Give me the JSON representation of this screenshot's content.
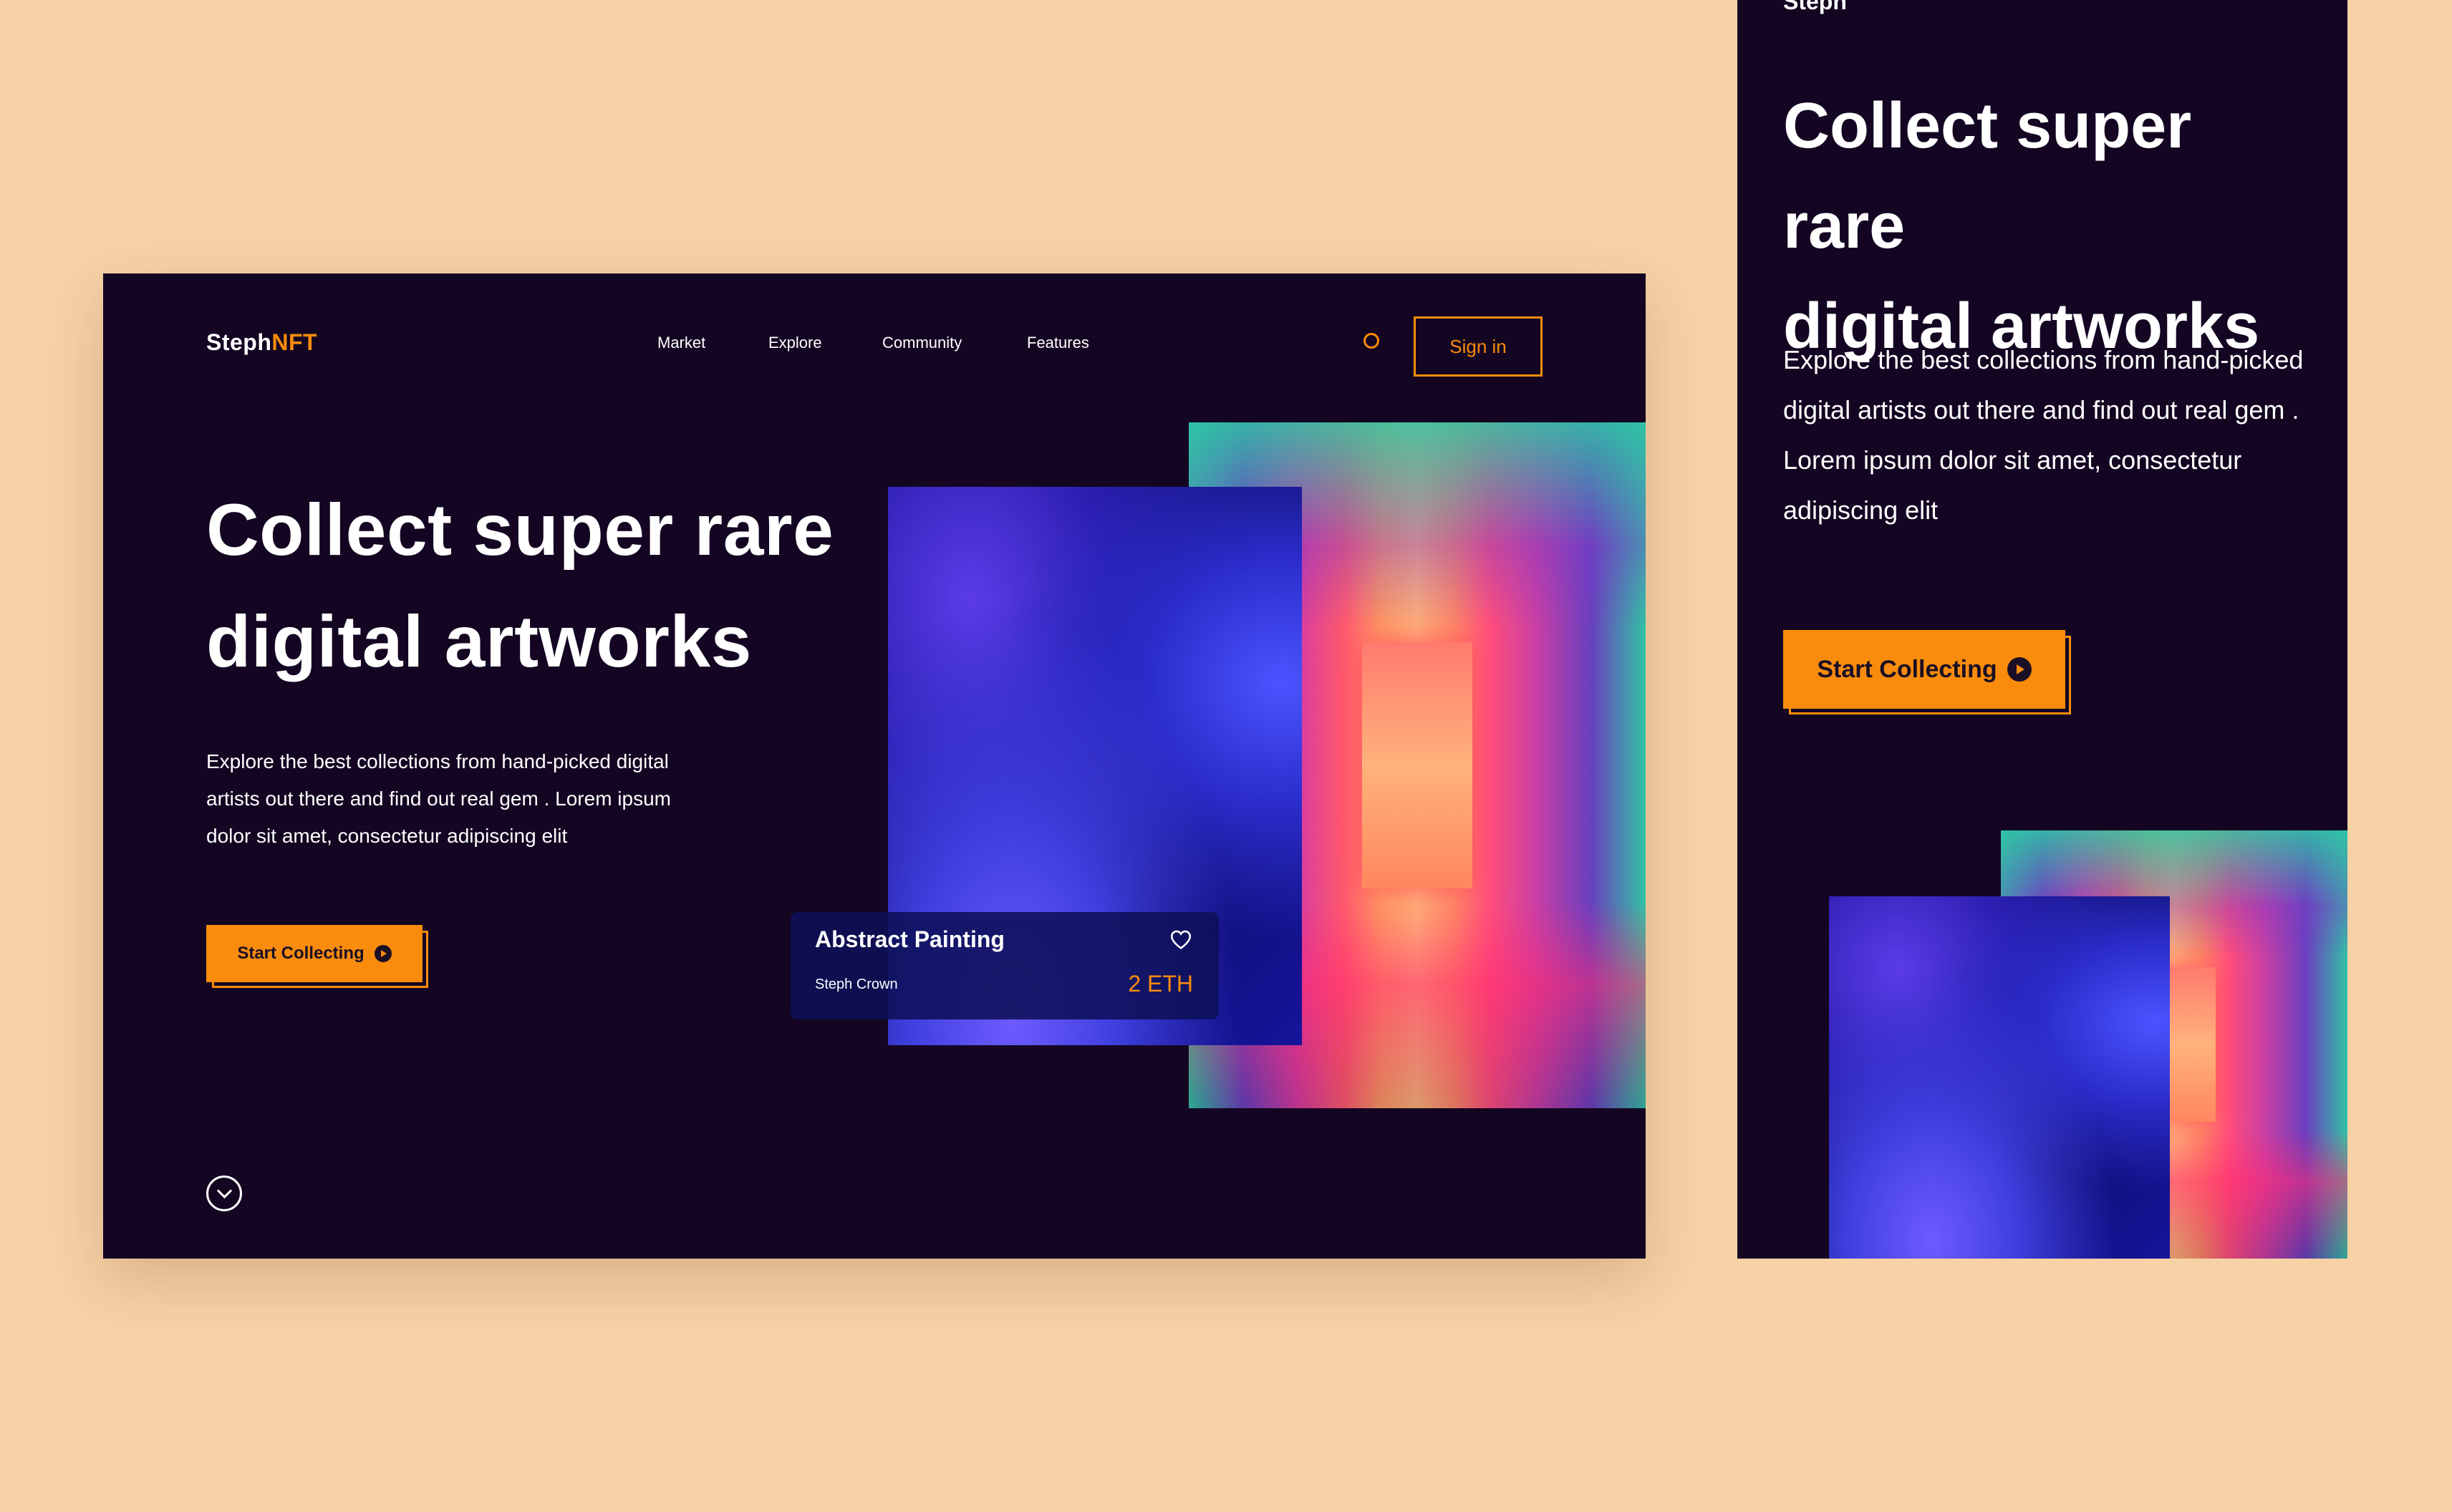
{
  "desktop": {
    "brand": {
      "primary": "Steph",
      "accent": "NFT"
    },
    "nav": [
      "Market",
      "Explore",
      "Community",
      "Features"
    ],
    "sign_in": "Sign in",
    "hero": {
      "title_line1": "Collect super rare",
      "title_line2": "digital artworks",
      "description": "Explore the best collections from hand-picked digital artists out there and find out real gem . Lorem ipsum dolor sit amet, consectetur adipiscing elit",
      "cta": "Start Collecting"
    },
    "card": {
      "title": "Abstract Painting",
      "artist": "Steph Crown",
      "price": "2 ETH"
    },
    "icons": [
      "search-icon",
      "heart-icon",
      "play-icon",
      "chevron-down-icon"
    ]
  },
  "mobile": {
    "hero": {
      "title_line1": "Collect super rare",
      "title_line2": "digital artworks",
      "description": "Explore the best collections from hand-picked digital artists out there and find out real gem . Lorem ipsum dolor sit amet, consectetur adipiscing elit",
      "cta": "Start Collecting"
    }
  },
  "colors": {
    "background": "#F7D2A6",
    "surface": "#140622",
    "accent": "#F98C0C",
    "text": "#FFFFFF"
  }
}
